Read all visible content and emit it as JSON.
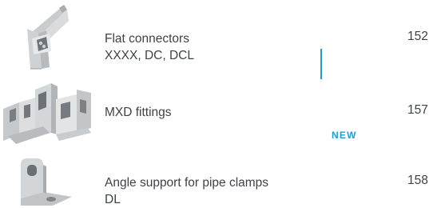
{
  "catalog": {
    "items": [
      {
        "name_line1": "Flat connectors",
        "name_line2": "XXXX, DC, DCL",
        "page": "152",
        "thumbnail_icon": "flat-connector-icon"
      },
      {
        "name_line1": "MXD fittings",
        "page": "157",
        "badge": "NEW",
        "thumbnail_icon": "mxd-fitting-icon"
      },
      {
        "name_line1": "Angle support for pipe clamps",
        "name_line2": "DL",
        "page": "158",
        "thumbnail_icon": "angle-support-icon"
      }
    ],
    "colors": {
      "accent": "#1d9fd0",
      "text": "#3d4246",
      "metal_light": "#e4e6e8",
      "metal_mid": "#c3c6c9",
      "metal_dark": "#8e9296"
    }
  }
}
